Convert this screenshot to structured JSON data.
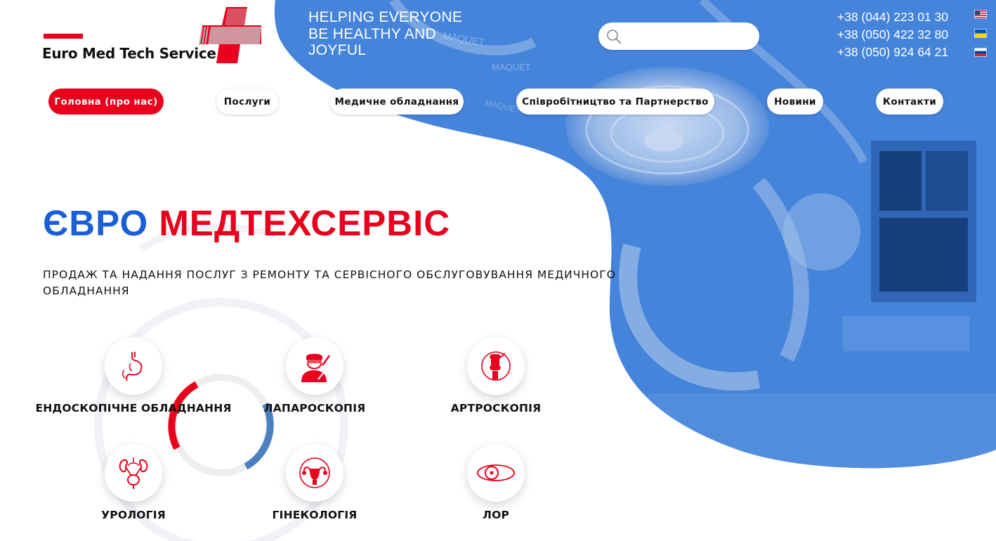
{
  "brand": {
    "name": "Euro Med Tech Service",
    "tagline": "HELPING EVERYONE BE HEALTHY AND JOYFUL"
  },
  "search": {
    "placeholder": ""
  },
  "contacts": {
    "phones": [
      "+38 (044) 223 01 30",
      "+38 (050) 422 32 80",
      "+38 (050) 924 64 21"
    ]
  },
  "languages": [
    "us-flag-icon",
    "ua-flag-icon",
    "ru-flag-icon"
  ],
  "nav": [
    {
      "label": "Головна (про нас)",
      "active": true
    },
    {
      "label": "Послуги"
    },
    {
      "label": "Медичне обладнання"
    },
    {
      "label": "Співробітництво та Партнерство"
    },
    {
      "label": "Новини"
    },
    {
      "label": "Контакти"
    }
  ],
  "hero": {
    "title_part1": "ЄВРО",
    "title_part2": "МЕДТЕХСЕРВІС",
    "subtitle": "ПРОДАЖ ТА НАДАННЯ ПОСЛУГ З РЕМОНТУ ТА СЕРВІСНОГО ОБСЛУГОВУВАННЯ МЕДИЧНОГО ОБЛАДНАННЯ"
  },
  "services": [
    {
      "label": "ЕНДОСКОПІЧНЕ ОБЛАДНАННЯ",
      "icon": "stomach-icon"
    },
    {
      "label": "ЛАПАРОСКОПІЯ",
      "icon": "surgeon-icon"
    },
    {
      "label": "АРТРОСКОПІЯ",
      "icon": "joint-icon"
    },
    {
      "label": "УРОЛОГІЯ",
      "icon": "kidneys-icon"
    },
    {
      "label": "ГІНЕКОЛОГІЯ",
      "icon": "uterus-icon"
    },
    {
      "label": "ЛОР",
      "icon": "head-mirror-icon"
    }
  ],
  "colors": {
    "brand_red": "#e8001c",
    "brand_blue": "#1a5fd6",
    "hero_blue": "#3a7fd6"
  }
}
